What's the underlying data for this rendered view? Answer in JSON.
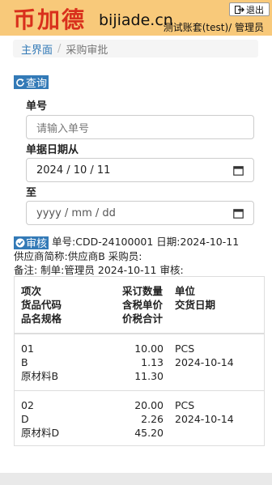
{
  "header": {
    "logo_cn": "币加德",
    "logo_en": "bijiade.cn",
    "logout_label": "退出",
    "account": "测试账套(test)/ 管理员"
  },
  "breadcrumb": {
    "home": "主界面",
    "current": "采购审批"
  },
  "query_button": "查询",
  "form": {
    "order_no_label": "单号",
    "order_no_placeholder": "请输入单号",
    "date_from_label": "单据日期从",
    "date_from_value": "2024 / 10 / 11",
    "date_to_label": "至",
    "date_to_placeholder": "yyyy / mm / dd"
  },
  "audit": {
    "button": "审核",
    "line1": "单号:CDD-24100001 日期:2024-10-11",
    "line2": "供应商简称:供应商B 采购员:",
    "line3": "备注: 制单:管理员 2024-10-11 审核:"
  },
  "table": {
    "headers": {
      "col1": [
        "项次",
        "货品代码",
        "品名规格"
      ],
      "col2": [
        "采订数量",
        "含税单价",
        "价税合计"
      ],
      "col3": [
        "单位",
        "交货日期"
      ]
    },
    "rows": [
      {
        "item": "01",
        "code": "B",
        "name": "原材料B",
        "qty": "10.00",
        "price": "1.13",
        "total": "11.30",
        "unit": "PCS",
        "date": "2024-10-14"
      },
      {
        "item": "02",
        "code": "D",
        "name": "原材料D",
        "qty": "20.00",
        "price": "2.26",
        "total": "45.20",
        "unit": "PCS",
        "date": "2024-10-14"
      }
    ]
  }
}
